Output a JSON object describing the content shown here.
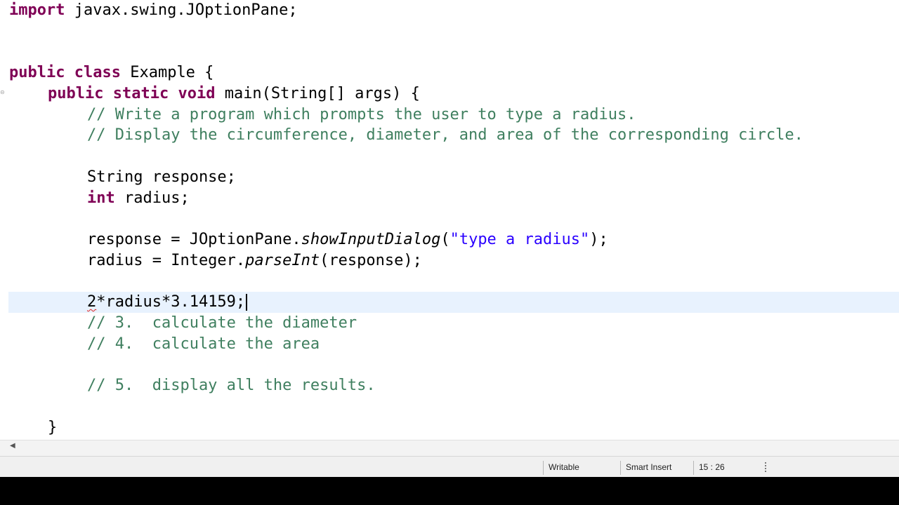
{
  "code": {
    "import_kw": "import",
    "import_rest": " javax.swing.JOptionPane;",
    "class_kw1": "public",
    "class_kw2": "class",
    "class_rest": " Example {",
    "main_kw1": "public",
    "main_kw2": "static",
    "main_kw3": "void",
    "main_rest": " main(String[] args) {",
    "comment1": "// Write a program which prompts the user to type a radius.",
    "comment2": "// Display the circumference, diameter, and area of the corresponding circle.",
    "decl_string": "String response;",
    "int_kw": "int",
    "int_rest": " radius;",
    "resp_prefix": "response = JOptionPane.",
    "resp_method": "showInputDialog",
    "resp_open": "(",
    "resp_string": "\"type a radius\"",
    "resp_close": ");",
    "parse_prefix": "radius = Integer.",
    "parse_method": "parseInt",
    "parse_rest": "(response);",
    "expr_error": "2",
    "expr_rest": "*radius*3.14159;",
    "comment3": "// 3.  calculate the diameter",
    "comment4": "// 4.  calculate the area",
    "comment5": "// 5.  display all the results.",
    "closing_brace": "}"
  },
  "status": {
    "writable": "Writable",
    "insert_mode": "Smart Insert",
    "position": "15 : 26"
  },
  "icons": {
    "fold": "fold-collapse-icon",
    "scroll_left": "scroll-left-arrow-icon",
    "grip": "status-grip-icon"
  },
  "colors": {
    "keyword": "#7f0055",
    "comment": "#3f7f5f",
    "string": "#2a00ff",
    "current_line": "#e8f2fe"
  }
}
